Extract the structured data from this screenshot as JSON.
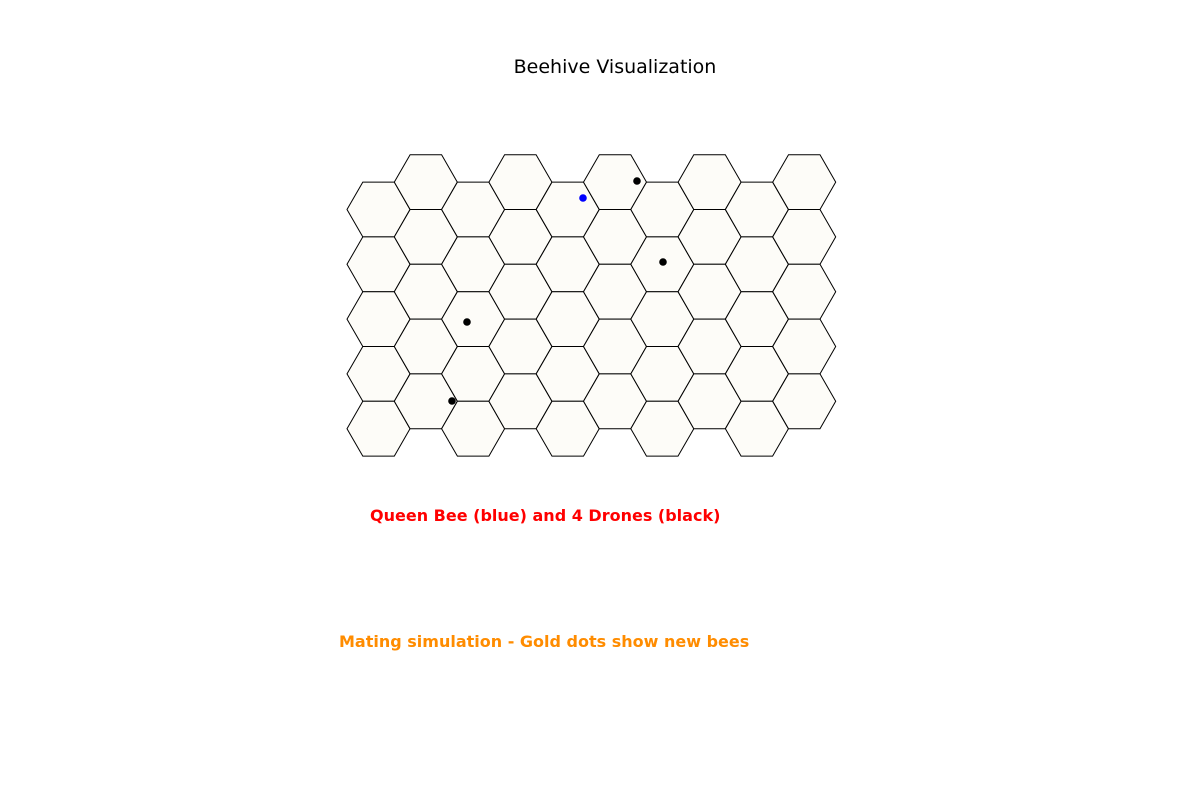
{
  "title": "Beehive Visualization",
  "captions": {
    "bees": "Queen Bee (blue) and 4 Drones (black)",
    "mating": "Mating simulation - Gold dots show new bees"
  },
  "colors": {
    "cell_fill": "#fdfcf8",
    "cell_stroke": "#000000",
    "queen": "#0000ff",
    "drone": "#000000",
    "bees_caption": "#ff0000",
    "mating_caption": "#ff8c00"
  },
  "hive": {
    "columns": 10,
    "rows_per_column": 5,
    "bees": [
      {
        "role": "queen",
        "color": "blue"
      },
      {
        "role": "drone",
        "color": "black"
      },
      {
        "role": "drone",
        "color": "black"
      },
      {
        "role": "drone",
        "color": "black"
      },
      {
        "role": "drone",
        "color": "black"
      }
    ]
  }
}
